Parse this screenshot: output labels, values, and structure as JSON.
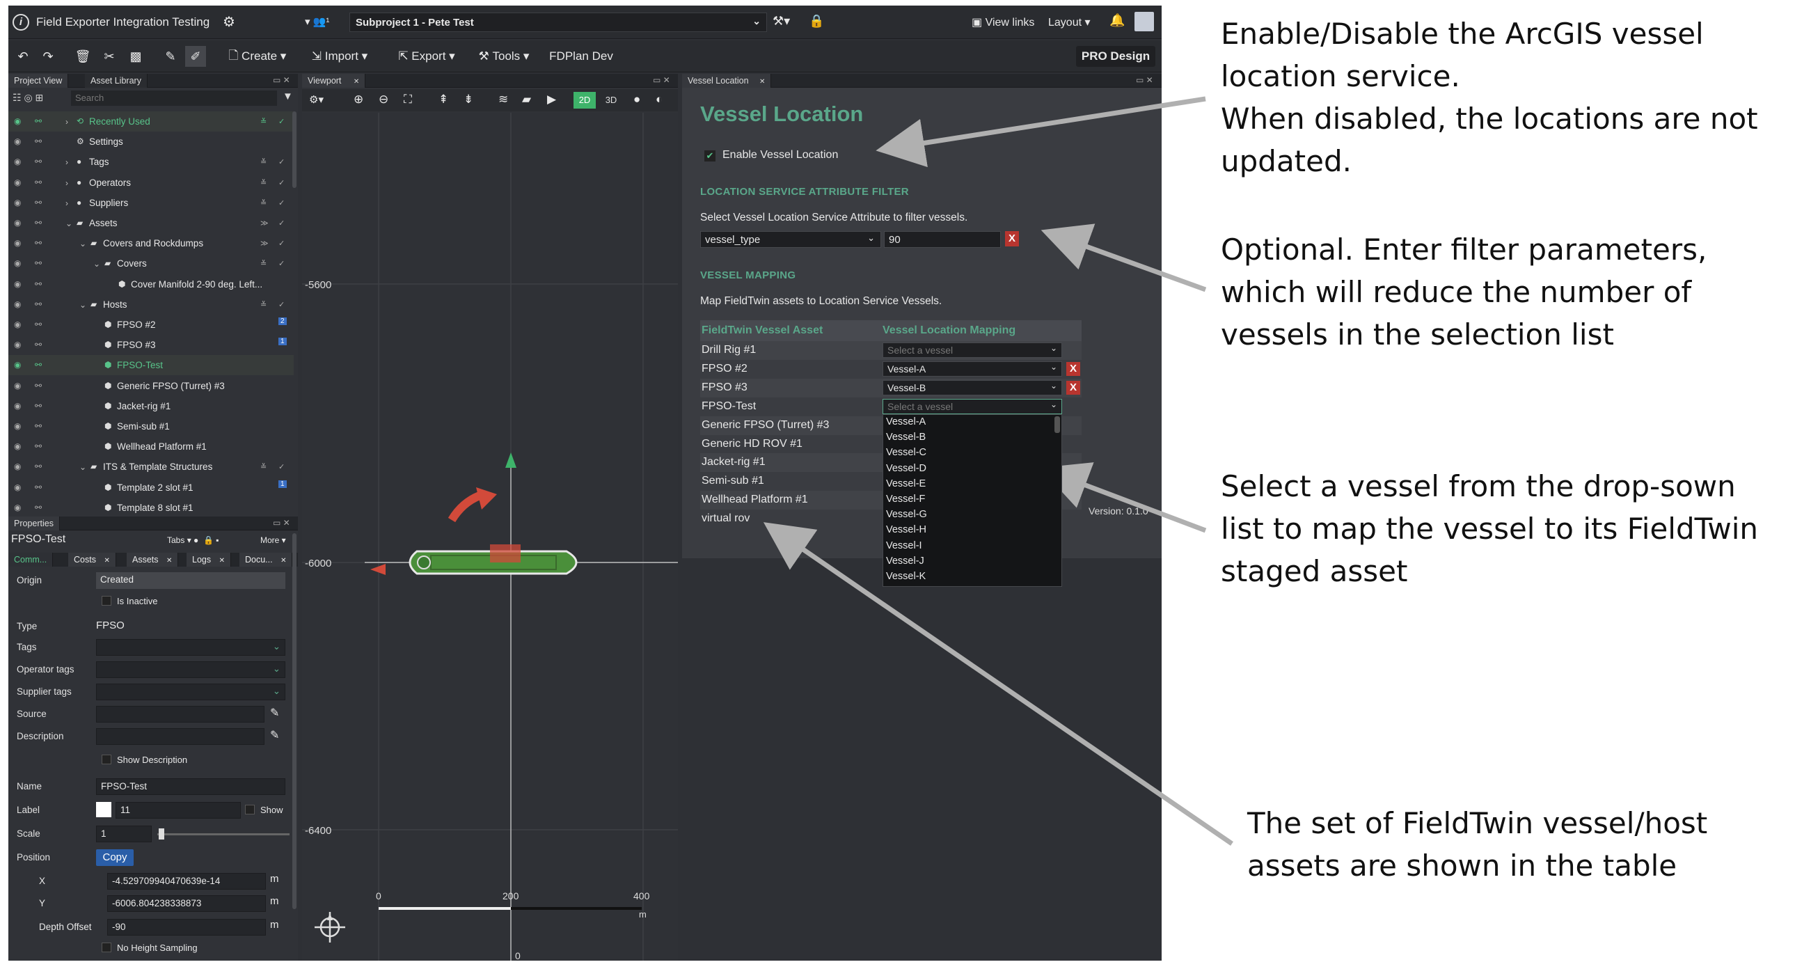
{
  "app": {
    "title": "Field Exporter Integration Testing",
    "project": "Subproject 1 - Pete Test",
    "view_links": "View links",
    "layout": "Layout",
    "pro": "PRO Design"
  },
  "toolbar": {
    "create": "Create",
    "import": "Import",
    "export": "Export",
    "tools": "Tools",
    "fdplan": "FDPlan Dev"
  },
  "left_panel": {
    "tabs": [
      "Project View",
      "Asset Library"
    ],
    "search_placeholder": "Search",
    "tree": [
      {
        "label": "Recently Used",
        "active": true
      },
      {
        "label": "Settings"
      },
      {
        "label": "Tags"
      },
      {
        "label": "Operators"
      },
      {
        "label": "Suppliers"
      },
      {
        "label": "Assets"
      },
      {
        "label": "Covers and Rockdumps"
      },
      {
        "label": "Covers"
      },
      {
        "label": "Cover Manifold 2-90 deg. Left..."
      },
      {
        "label": "Hosts"
      },
      {
        "label": "FPSO #2",
        "badge": "2"
      },
      {
        "label": "FPSO #3",
        "badge": "1"
      },
      {
        "label": "FPSO-Test",
        "active": true
      },
      {
        "label": "Generic FPSO (Turret) #3"
      },
      {
        "label": "Jacket-rig #1"
      },
      {
        "label": "Semi-sub #1"
      },
      {
        "label": "Wellhead Platform #1"
      },
      {
        "label": "ITS & Template Structures"
      },
      {
        "label": "Template 2 slot #1",
        "badge": "1"
      },
      {
        "label": "Template 8 slot #1"
      }
    ]
  },
  "properties": {
    "header": "Properties",
    "name": "FPSO-Test",
    "tabs_btn": "Tabs",
    "more_btn": "More",
    "subtabs": [
      "Comm...",
      "Costs",
      "Assets",
      "Logs",
      "Docu..."
    ],
    "origin_label": "Origin",
    "origin_value": "Created",
    "is_inactive": "Is Inactive",
    "type_label": "Type",
    "type_value": "FPSO",
    "tags_label": "Tags",
    "operator_tags_label": "Operator tags",
    "supplier_tags_label": "Supplier tags",
    "source_label": "Source",
    "description_label": "Description",
    "show_description": "Show Description",
    "name_label": "Name",
    "name_value": "FPSO-Test",
    "label_label": "Label",
    "label_value": "11",
    "show": "Show",
    "scale_label": "Scale",
    "scale_value": "1",
    "position_label": "Position",
    "copy": "Copy",
    "x_label": "X",
    "x_value": "-4.529709940470639e-14",
    "y_label": "Y",
    "y_value": "-6006.804238338873",
    "depth_label": "Depth Offset",
    "depth_value": "-90",
    "unit": "m",
    "no_height": "No Height Sampling"
  },
  "viewport": {
    "tab": "Viewport",
    "mode_2d": "2D",
    "mode_3d": "3D",
    "y_ticks": [
      "-5600",
      "-6000",
      "-6400"
    ],
    "scale_ticks": [
      "0",
      "200",
      "400"
    ],
    "scale_unit": "m",
    "x_tick": "0"
  },
  "vessel": {
    "tab": "Vessel Location",
    "title": "Vessel Location",
    "enable_label": "Enable Vessel Location",
    "filter_heading": "LOCATION SERVICE ATTRIBUTE FILTER",
    "filter_text": "Select Vessel Location Service Attribute to filter vessels.",
    "filter_attr": "vessel_type",
    "filter_value": "90",
    "mapping_heading": "VESSEL MAPPING",
    "mapping_text": "Map FieldTwin assets to Location Service Vessels.",
    "col1": "FieldTwin Vessel Asset",
    "col2": "Vessel Location Mapping",
    "rows": [
      {
        "asset": "Drill Rig #1",
        "mapping": "Select a vessel"
      },
      {
        "asset": "FPSO #2",
        "mapping": "Vessel-A"
      },
      {
        "asset": "FPSO #3",
        "mapping": "Vessel-B"
      },
      {
        "asset": "FPSO-Test",
        "mapping": "Select a vessel"
      },
      {
        "asset": "Generic FPSO (Turret) #3"
      },
      {
        "asset": "Generic HD ROV #1"
      },
      {
        "asset": "Jacket-rig #1"
      },
      {
        "asset": "Semi-sub #1"
      },
      {
        "asset": "Wellhead Platform #1"
      },
      {
        "asset": "virtual rov"
      }
    ],
    "dropdown": [
      "Vessel-A",
      "Vessel-B",
      "Vessel-C",
      "Vessel-D",
      "Vessel-E",
      "Vessel-F",
      "Vessel-G",
      "Vessel-H",
      "Vessel-I",
      "Vessel-J",
      "Vessel-K"
    ],
    "version": "Version: 0.1.0"
  },
  "callouts": {
    "c1": [
      "Enable/Disable the ArcGIS vessel",
      "location service.",
      "When disabled, the locations are not",
      "updated."
    ],
    "c2": [
      "Optional. Enter filter parameters,",
      "which will reduce the number of",
      "vessels in the selection list"
    ],
    "c3": [
      "Select a vessel from the drop-sown",
      "list to map the vessel to its FieldTwin",
      "staged asset"
    ],
    "c4": [
      "The set of FieldTwin vessel/host",
      "assets are shown in the table"
    ]
  },
  "colors": {
    "accent_green": "#5aa78a",
    "selected_green": "#58c48a",
    "delete_red": "#b8352f",
    "copy_blue": "#2a5ea8"
  }
}
